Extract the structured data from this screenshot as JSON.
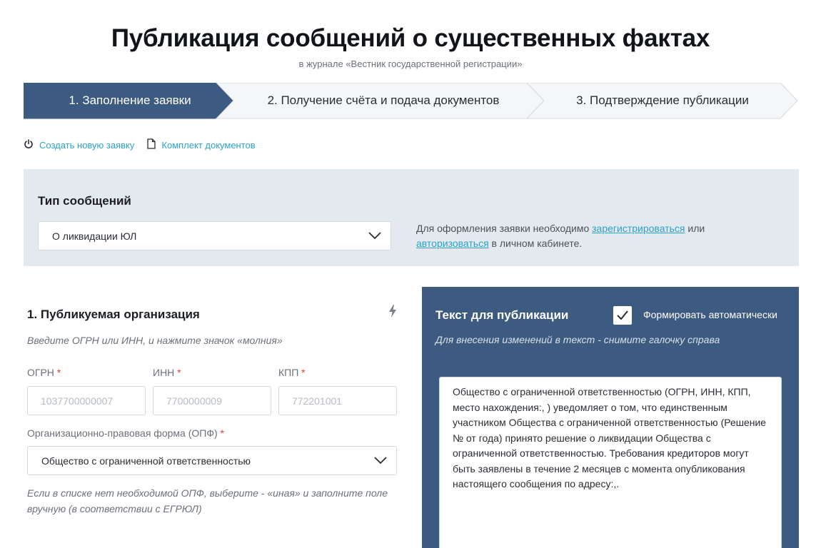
{
  "header": {
    "title": "Публикация сообщений о существенных фактах",
    "subtitle": "в журнале «Вестник государственной регистрации»"
  },
  "steps": [
    {
      "label": "1. Заполнение заявки",
      "active": true
    },
    {
      "label": "2. Получение счёта и подача документов",
      "active": false
    },
    {
      "label": "3. Подтверждение публикации",
      "active": false
    }
  ],
  "links": {
    "new_request": "Создать новую заявку",
    "documents": "Комплект документов"
  },
  "message_type": {
    "label": "Тип сообщений",
    "selected": "О ликвидации ЮЛ",
    "note_before": "Для оформления заявки необходимо ",
    "register_link": "зарегистрироваться",
    "note_middle": " или ",
    "login_link": "авторизоваться",
    "note_after": " в личном кабинете."
  },
  "organization": {
    "title": "1. Публикуемая организация",
    "hint": "Введите ОГРН или ИНН, и нажмите значок «молния»",
    "ogrn_label": "ОГРН",
    "ogrn_placeholder": "1037700000007",
    "inn_label": "ИНН",
    "inn_placeholder": "7700000009",
    "kpp_label": "КПП",
    "kpp_placeholder": "772201001",
    "required_mark": "*",
    "opf_label": "Организационно-правовая форма (ОПФ)",
    "opf_selected": "Общество с ограниченной ответственностью",
    "opf_hint": "Если в списке нет необходимой ОПФ, выберите - «иная» и заполните поле вручную (в соответствии с ЕГРЮЛ)"
  },
  "publication": {
    "title": "Текст для публикации",
    "auto_checked": true,
    "auto_label": "Формировать автоматически",
    "hint": "Для внесения изменений в текст - снимите галочку справа",
    "text": "Общество с ограниченной ответственностью (ОГРН, ИНН, КПП, место нахождения:, ) уведомляет о том, что единственным участником Общества с ограниченной ответственностью (Решение № от года) принято решение о ликвидации Общества с ограниченной ответственностью. Требования кредиторов могут быть заявлены в течение 2 месяцев с момента опубликования настоящего сообщения по адресу:,."
  },
  "colors": {
    "step_active": "#3d5a80",
    "link": "#2aa3c8",
    "panel": "#e3e9ef",
    "required": "#e23b3b"
  }
}
